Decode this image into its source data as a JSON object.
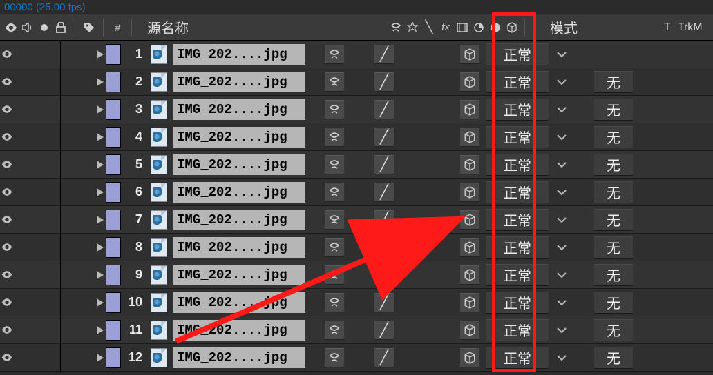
{
  "timecode": "00000 (25.00 fps)",
  "header": {
    "source_label": "源名称",
    "mode_label": "模式",
    "t_label": "T",
    "trk_label": "TrkM"
  },
  "mode_value": "正常",
  "trk_value": "无",
  "layers": [
    {
      "index": "1",
      "name": "IMG_202....jpg",
      "show_trk": false
    },
    {
      "index": "2",
      "name": "IMG_202....jpg",
      "show_trk": true
    },
    {
      "index": "3",
      "name": "IMG_202....jpg",
      "show_trk": true
    },
    {
      "index": "4",
      "name": "IMG_202....jpg",
      "show_trk": true
    },
    {
      "index": "5",
      "name": "IMG_202....jpg",
      "show_trk": true
    },
    {
      "index": "6",
      "name": "IMG_202....jpg",
      "show_trk": true
    },
    {
      "index": "7",
      "name": "IMG_202....jpg",
      "show_trk": true
    },
    {
      "index": "8",
      "name": "IMG_202....jpg",
      "show_trk": true
    },
    {
      "index": "9",
      "name": "IMG_202....jpg",
      "show_trk": true
    },
    {
      "index": "10",
      "name": "IMG_202....jpg",
      "show_trk": true
    },
    {
      "index": "11",
      "name": "IMG_202....jpg",
      "show_trk": true
    },
    {
      "index": "12",
      "name": "IMG_202....jpg",
      "show_trk": true
    }
  ]
}
